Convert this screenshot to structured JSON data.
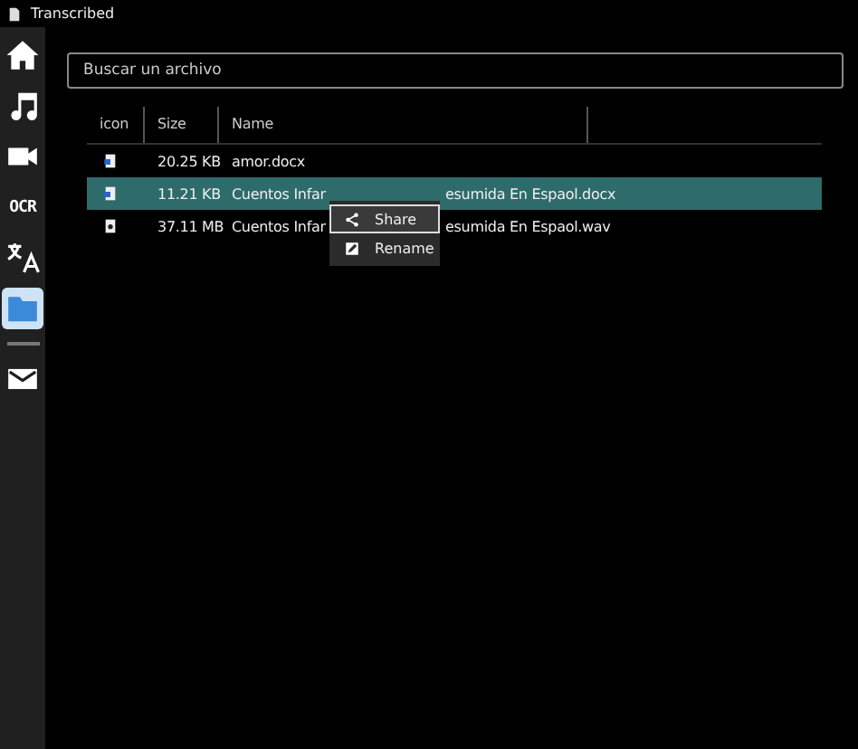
{
  "window": {
    "title": "Transcribed"
  },
  "sidebar": {
    "items": [
      {
        "kind": "home",
        "selected": false
      },
      {
        "kind": "music",
        "selected": false
      },
      {
        "kind": "video",
        "selected": false
      },
      {
        "kind": "ocr",
        "label": "OCR",
        "selected": false
      },
      {
        "kind": "translate",
        "selected": false
      },
      {
        "kind": "folder",
        "selected": true
      },
      {
        "kind": "mail",
        "selected": false
      }
    ]
  },
  "search": {
    "placeholder": "Buscar un archivo"
  },
  "table": {
    "columns": [
      "icon",
      "Size",
      "Name"
    ],
    "rows": [
      {
        "kind": "doc",
        "size": "20.25 KB",
        "name": "amor.docx",
        "selected": false
      },
      {
        "kind": "doc",
        "size": "11.21 KB",
        "name": "Cuentos Infar",
        "name_end": "esumida En Espaol.docx",
        "selected": true
      },
      {
        "kind": "audio",
        "size": "37.11 MB",
        "name": "Cuentos Infar",
        "name_end": "esumida En Espaol.wav",
        "selected": false
      }
    ]
  },
  "context_menu": {
    "items": [
      {
        "kind": "share",
        "label": "Share",
        "selected": true
      },
      {
        "kind": "rename",
        "label": "Rename",
        "selected": false
      }
    ]
  }
}
